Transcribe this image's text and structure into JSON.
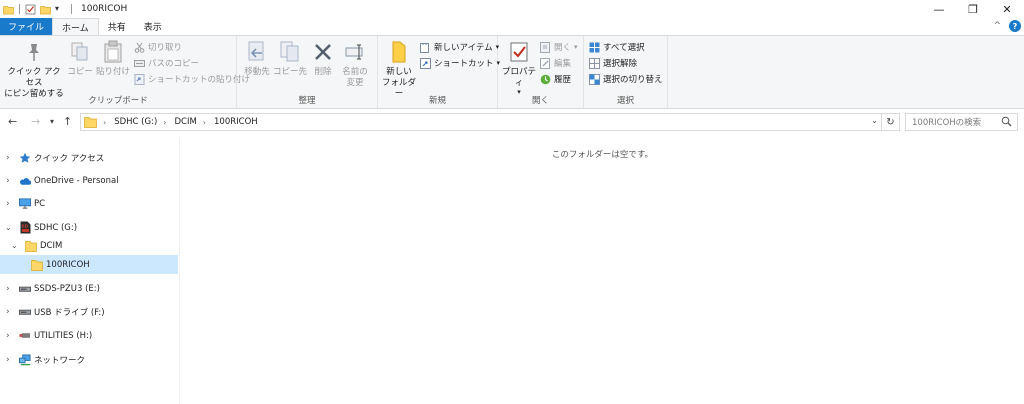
{
  "window": {
    "title": "100RICOH",
    "minimize": "—",
    "restore": "❐",
    "close": "✕"
  },
  "tabs": {
    "file": "ファイル",
    "home": "ホーム",
    "share": "共有",
    "view": "表示",
    "collapse": "^",
    "help": "?"
  },
  "ribbon": {
    "clipboard": {
      "label": "クリップボード",
      "pin_line1": "クイック アクセス",
      "pin_line2": "にピン留めする",
      "copy": "コピー",
      "paste": "貼り付け",
      "cut": "切り取り",
      "copy_path": "パスのコピー",
      "paste_shortcut": "ショートカットの貼り付け"
    },
    "organize": {
      "label": "整理",
      "move_to": "移動先",
      "copy_to": "コピー先",
      "delete": "削除",
      "rename_line1": "名前の",
      "rename_line2": "変更"
    },
    "new": {
      "label": "新規",
      "new_folder_line1": "新しい",
      "new_folder_line2": "フォルダー",
      "new_item": "新しいアイテム",
      "easy_access": "ショートカット"
    },
    "open": {
      "label": "開く",
      "properties": "プロパティ",
      "open": "開く",
      "edit": "編集",
      "history": "履歴"
    },
    "select": {
      "label": "選択",
      "select_all": "すべて選択",
      "select_none": "選択解除",
      "invert": "選択の切り替え"
    }
  },
  "address": {
    "crumbs": [
      "SDHC (G:)",
      "DCIM",
      "100RICOH"
    ],
    "search_placeholder": "100RICOHの検索"
  },
  "nav": {
    "quick_access": "クイック アクセス",
    "onedrive": "OneDrive - Personal",
    "pc": "PC",
    "sdhc": "SDHC (G:)",
    "dcim": "DCIM",
    "ricoh": "100RICOH",
    "ssds": "SSDS-PZU3 (E:)",
    "usb": "USB ドライブ (F:)",
    "utilities": "UTILITIES (H:)",
    "network": "ネットワーク"
  },
  "content": {
    "empty_message": "このフォルダーは空です。"
  },
  "colors": {
    "accent": "#1979ca",
    "selection": "#cce8ff",
    "folder": "#ffd766",
    "ribbon_bg": "#f5f6f7"
  }
}
